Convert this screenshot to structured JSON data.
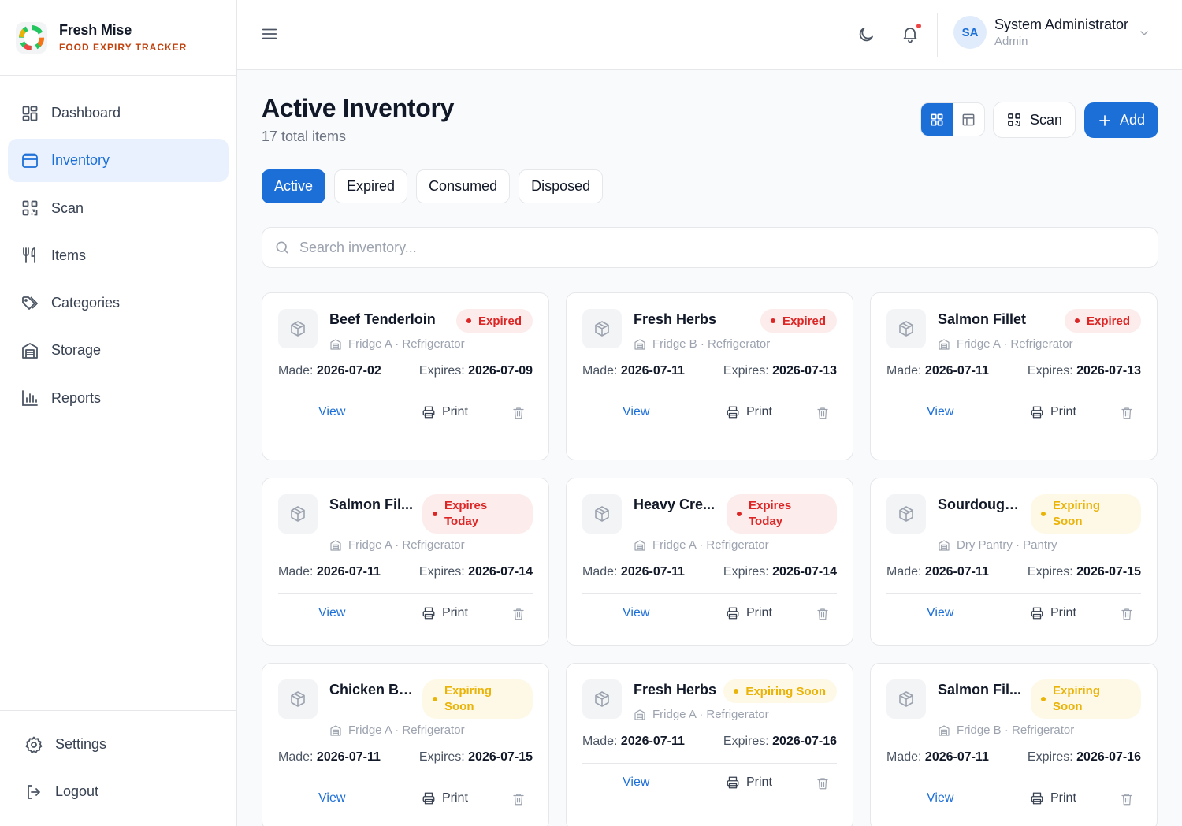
{
  "brand": {
    "name": "Fresh Mise",
    "tagline": "FOOD EXPIRY TRACKER"
  },
  "nav": [
    {
      "label": "Dashboard",
      "icon": "dashboard-icon",
      "active": false
    },
    {
      "label": "Inventory",
      "icon": "inventory-icon",
      "active": true
    },
    {
      "label": "Scan",
      "icon": "qr-scan-icon",
      "active": false
    },
    {
      "label": "Items",
      "icon": "utensils-icon",
      "active": false
    },
    {
      "label": "Categories",
      "icon": "tags-icon",
      "active": false
    },
    {
      "label": "Storage",
      "icon": "warehouse-icon",
      "active": false
    },
    {
      "label": "Reports",
      "icon": "bar-chart-icon",
      "active": false
    }
  ],
  "footer_nav": [
    {
      "label": "Settings",
      "icon": "gear-icon"
    },
    {
      "label": "Logout",
      "icon": "logout-icon"
    }
  ],
  "header": {
    "user_initials": "SA",
    "user_name": "System Administrator",
    "user_role": "Admin",
    "notification_dot": true
  },
  "page": {
    "title": "Active Inventory",
    "subtitle": "17 total items",
    "scan_label": "Scan",
    "add_label": "Add",
    "view_mode": "grid"
  },
  "tabs": [
    {
      "label": "Active",
      "active": true
    },
    {
      "label": "Expired",
      "active": false
    },
    {
      "label": "Consumed",
      "active": false
    },
    {
      "label": "Disposed",
      "active": false
    }
  ],
  "search": {
    "placeholder": "Search inventory...",
    "value": ""
  },
  "labels": {
    "made": "Made:",
    "expires": "Expires:",
    "view": "View",
    "print": "Print"
  },
  "items": [
    {
      "name": "Beef Tenderloin",
      "status": "Expired",
      "status_type": "expired",
      "location": "Fridge A · Refrigerator",
      "made": "2026-07-02",
      "expires": "2026-07-09"
    },
    {
      "name": "Fresh Herbs",
      "status": "Expired",
      "status_type": "expired",
      "location": "Fridge B · Refrigerator",
      "made": "2026-07-11",
      "expires": "2026-07-13"
    },
    {
      "name": "Salmon Fillet",
      "status": "Expired",
      "status_type": "expired",
      "location": "Fridge A · Refrigerator",
      "made": "2026-07-11",
      "expires": "2026-07-13"
    },
    {
      "name": "Salmon Fil...",
      "status": "Expires Today",
      "status_type": "expired",
      "location": "Fridge A · Refrigerator",
      "made": "2026-07-11",
      "expires": "2026-07-14"
    },
    {
      "name": "Heavy Cre...",
      "status": "Expires Today",
      "status_type": "expired",
      "location": "Fridge A · Refrigerator",
      "made": "2026-07-11",
      "expires": "2026-07-14"
    },
    {
      "name": "Sourdough ...",
      "status": "Expiring Soon",
      "status_type": "warn",
      "location": "Dry Pantry · Pantry",
      "made": "2026-07-11",
      "expires": "2026-07-15"
    },
    {
      "name": "Chicken Br...",
      "status": "Expiring Soon",
      "status_type": "warn",
      "location": "Fridge A · Refrigerator",
      "made": "2026-07-11",
      "expires": "2026-07-15"
    },
    {
      "name": "Fresh Herbs",
      "status": "Expiring Soon",
      "status_type": "warn",
      "location": "Fridge A · Refrigerator",
      "made": "2026-07-11",
      "expires": "2026-07-16"
    },
    {
      "name": "Salmon Fil...",
      "status": "Expiring Soon",
      "status_type": "warn",
      "location": "Fridge B · Refrigerator",
      "made": "2026-07-11",
      "expires": "2026-07-16"
    }
  ],
  "colors": {
    "accent": "#1d6fd8",
    "expired": "#dc2626",
    "warning": "#eab308",
    "brand_sub": "#c2410c"
  }
}
